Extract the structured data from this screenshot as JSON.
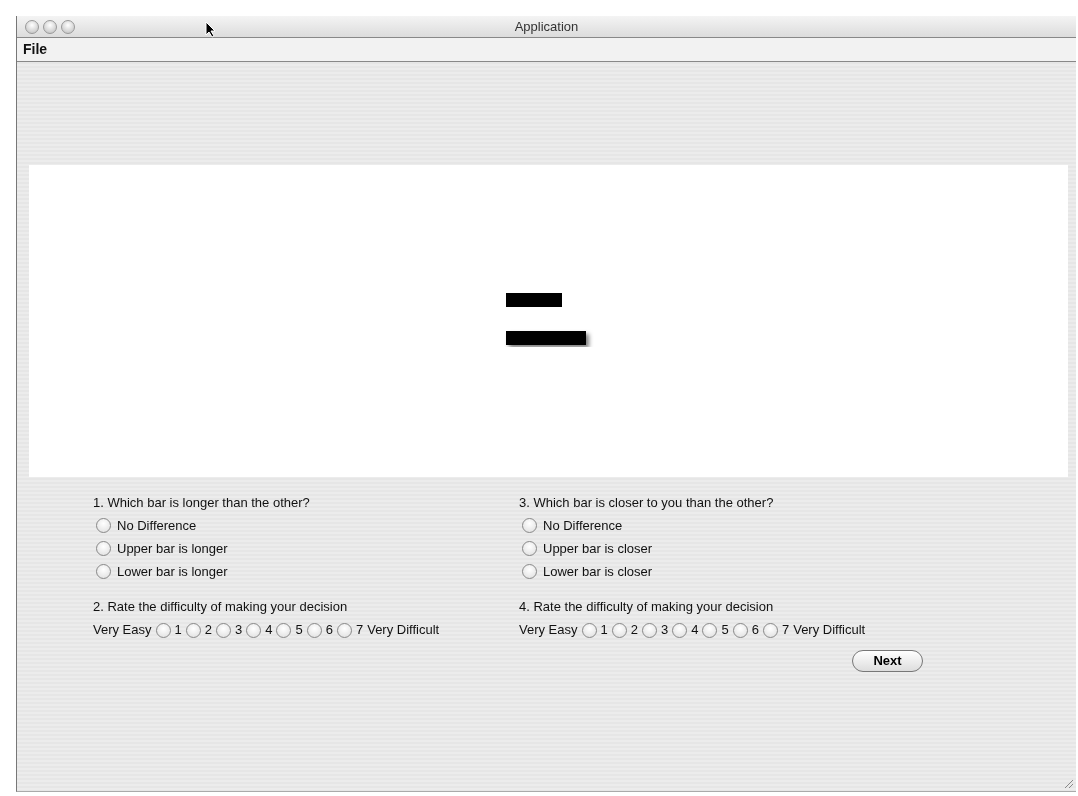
{
  "window": {
    "title": "Application"
  },
  "menu": [
    "File"
  ],
  "questions": [
    {
      "prompt": "1. Which bar is longer than the other?",
      "options": [
        {
          "label": "No Difference",
          "selected": false
        },
        {
          "label": "Upper bar is longer",
          "selected": false
        },
        {
          "label": "Lower bar is longer",
          "selected": false
        }
      ],
      "rating": {
        "prompt": "2. Rate the difficulty of making your decision",
        "low": "Very Easy",
        "high": "Very Difficult",
        "points": [
          {
            "label": "1",
            "selected": false
          },
          {
            "label": "2",
            "selected": false
          },
          {
            "label": "3",
            "selected": false
          },
          {
            "label": "4",
            "selected": false
          },
          {
            "label": "5",
            "selected": false
          },
          {
            "label": "6",
            "selected": false
          },
          {
            "label": "7",
            "selected": false
          }
        ]
      }
    },
    {
      "prompt": "3. Which bar is closer to you than the other?",
      "options": [
        {
          "label": "No Difference",
          "selected": false
        },
        {
          "label": "Upper bar is closer",
          "selected": false
        },
        {
          "label": "Lower bar is closer",
          "selected": false
        }
      ],
      "rating": {
        "prompt": "4. Rate the difficulty of making your decision",
        "low": "Very Easy",
        "high": "Very Difficult",
        "points": [
          {
            "label": "1",
            "selected": false
          },
          {
            "label": "2",
            "selected": false
          },
          {
            "label": "3",
            "selected": false
          },
          {
            "label": "4",
            "selected": false
          },
          {
            "label": "5",
            "selected": false
          },
          {
            "label": "6",
            "selected": false
          },
          {
            "label": "7",
            "selected": false
          }
        ]
      }
    }
  ],
  "buttons": [
    "Next"
  ]
}
